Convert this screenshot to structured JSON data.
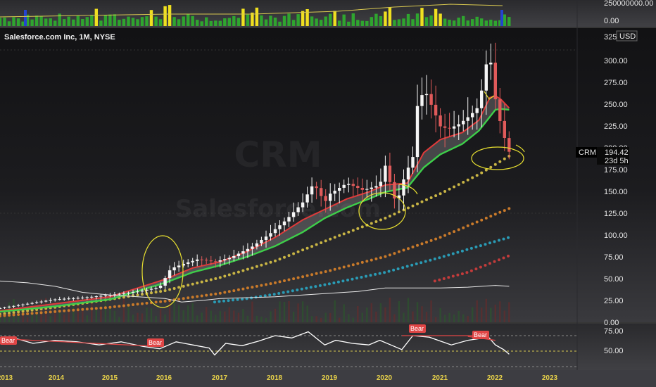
{
  "title": "Salesforce.com Inc, 1M, NYSE",
  "watermark": "Salesforce.com",
  "watermark_ticker": "CRM",
  "currency": "USD",
  "last_price": {
    "symbol": "CRM",
    "value": "194.42",
    "countdown": "23d 5h"
  },
  "volume_axis": [
    "250000000.00",
    "0.00"
  ],
  "price_ticks": [
    "325.0",
    "300.00",
    "275.00",
    "250.00",
    "225.00",
    "200.00",
    "175.00",
    "150.00",
    "125.00",
    "100.00",
    "75.00",
    "50.00",
    "25.00",
    "0.00"
  ],
  "rsi_ticks": [
    "75.00",
    "50.00"
  ],
  "time_ticks": [
    "2013",
    "2014",
    "2015",
    "2016",
    "2017",
    "2018",
    "2019",
    "2020",
    "2021",
    "2022",
    "2023"
  ],
  "rsi_badges": [
    "Bear",
    "Bear",
    "Bear",
    "Bear"
  ],
  "colors": {
    "up": "#f5f5f5",
    "down": "#e05a5a",
    "ema_fast": "#e03a3a",
    "ema_slow": "#3ecf4a",
    "ma_yellow": "#c9b545",
    "ma_orange": "#c97a2a",
    "ma_blue": "#2a9bb5",
    "ma_red": "#c23b3b",
    "annotation": "#e8e030",
    "axis_text": "#e6e6e6",
    "year_text": "#e8d24a"
  },
  "chart_data": {
    "type": "candlestick",
    "title": "Salesforce.com Inc, 1M, NYSE",
    "x_range": [
      2013.0,
      2023.6
    ],
    "ylim": [
      0,
      325
    ],
    "price_path": [
      [
        2013.0,
        17
      ],
      [
        2013.5,
        22
      ],
      [
        2014.0,
        27
      ],
      [
        2014.5,
        29
      ],
      [
        2015.0,
        32
      ],
      [
        2015.5,
        36
      ],
      [
        2015.9,
        41
      ],
      [
        2016.1,
        62
      ],
      [
        2016.3,
        67
      ],
      [
        2016.6,
        73
      ],
      [
        2016.9,
        70
      ],
      [
        2017.2,
        75
      ],
      [
        2017.6,
        88
      ],
      [
        2017.9,
        102
      ],
      [
        2018.2,
        118
      ],
      [
        2018.5,
        138
      ],
      [
        2018.7,
        160
      ],
      [
        2018.9,
        138
      ],
      [
        2019.0,
        148
      ],
      [
        2019.3,
        160
      ],
      [
        2019.6,
        152
      ],
      [
        2019.9,
        158
      ],
      [
        2020.0,
        180
      ],
      [
        2020.2,
        135
      ],
      [
        2020.35,
        168
      ],
      [
        2020.5,
        190
      ],
      [
        2020.6,
        260
      ],
      [
        2020.75,
        262
      ],
      [
        2020.9,
        240
      ],
      [
        2021.0,
        225
      ],
      [
        2021.15,
        222
      ],
      [
        2021.35,
        228
      ],
      [
        2021.55,
        238
      ],
      [
        2021.7,
        248
      ],
      [
        2021.85,
        302
      ],
      [
        2021.95,
        296
      ],
      [
        2022.0,
        256
      ],
      [
        2022.08,
        232
      ],
      [
        2022.17,
        211
      ],
      [
        2022.25,
        196
      ]
    ],
    "ema_fast_path": [
      [
        2013.0,
        14
      ],
      [
        2014.0,
        22
      ],
      [
        2015.0,
        30
      ],
      [
        2016.0,
        50
      ],
      [
        2016.5,
        63
      ],
      [
        2017.0,
        70
      ],
      [
        2017.5,
        82
      ],
      [
        2018.0,
        98
      ],
      [
        2018.5,
        118
      ],
      [
        2018.9,
        130
      ],
      [
        2019.3,
        142
      ],
      [
        2019.7,
        150
      ],
      [
        2020.0,
        158
      ],
      [
        2020.4,
        160
      ],
      [
        2020.7,
        195
      ],
      [
        2021.0,
        210
      ],
      [
        2021.4,
        218
      ],
      [
        2021.7,
        232
      ],
      [
        2021.9,
        258
      ],
      [
        2022.0,
        260
      ],
      [
        2022.1,
        256
      ],
      [
        2022.25,
        246
      ]
    ],
    "ema_slow_path": [
      [
        2013.0,
        13
      ],
      [
        2014.0,
        19
      ],
      [
        2015.0,
        27
      ],
      [
        2016.0,
        46
      ],
      [
        2016.5,
        58
      ],
      [
        2017.0,
        66
      ],
      [
        2017.5,
        76
      ],
      [
        2018.0,
        88
      ],
      [
        2018.5,
        104
      ],
      [
        2018.9,
        120
      ],
      [
        2019.3,
        132
      ],
      [
        2019.7,
        142
      ],
      [
        2020.0,
        150
      ],
      [
        2020.4,
        155
      ],
      [
        2020.7,
        178
      ],
      [
        2021.0,
        193
      ],
      [
        2021.4,
        205
      ],
      [
        2021.7,
        220
      ],
      [
        2021.9,
        236
      ],
      [
        2022.0,
        244
      ],
      [
        2022.1,
        245
      ],
      [
        2022.25,
        244
      ]
    ],
    "ma_yellow_path": [
      [
        2013.0,
        10
      ],
      [
        2014.0,
        18
      ],
      [
        2015.0,
        27
      ],
      [
        2016.0,
        37
      ],
      [
        2017.0,
        52
      ],
      [
        2018.0,
        71
      ],
      [
        2019.0,
        96
      ],
      [
        2020.0,
        120
      ],
      [
        2021.0,
        148
      ],
      [
        2021.7,
        170
      ],
      [
        2022.25,
        191
      ]
    ],
    "ma_orange_path": [
      [
        2013.0,
        8
      ],
      [
        2014.0,
        13
      ],
      [
        2015.0,
        18
      ],
      [
        2016.0,
        25
      ],
      [
        2017.0,
        34
      ],
      [
        2018.0,
        46
      ],
      [
        2019.0,
        60
      ],
      [
        2020.0,
        76
      ],
      [
        2021.0,
        98
      ],
      [
        2022.25,
        131
      ]
    ],
    "ma_blue_path": [
      [
        2016.9,
        24
      ],
      [
        2017.5,
        28
      ],
      [
        2018.0,
        33
      ],
      [
        2019.0,
        45
      ],
      [
        2020.0,
        58
      ],
      [
        2021.0,
        75
      ],
      [
        2022.25,
        98
      ]
    ],
    "ma_red_path": [
      [
        2020.9,
        48
      ],
      [
        2021.5,
        58
      ],
      [
        2022.25,
        77
      ]
    ],
    "white_line_path": [
      [
        2013.0,
        48
      ],
      [
        2013.5,
        46
      ],
      [
        2014.0,
        42
      ],
      [
        2014.5,
        35
      ],
      [
        2015.0,
        32
      ],
      [
        2015.5,
        30
      ],
      [
        2016.0,
        28
      ],
      [
        2016.3,
        24
      ],
      [
        2016.7,
        26
      ],
      [
        2017.0,
        28
      ],
      [
        2017.5,
        29
      ],
      [
        2018.0,
        30
      ],
      [
        2018.5,
        32
      ],
      [
        2019.0,
        34
      ],
      [
        2019.5,
        36
      ],
      [
        2020.0,
        40
      ],
      [
        2020.5,
        40
      ],
      [
        2021.0,
        40
      ],
      [
        2021.5,
        41
      ],
      [
        2022.0,
        43
      ],
      [
        2022.25,
        42
      ]
    ],
    "rsi_path": [
      [
        2013.0,
        64
      ],
      [
        2013.3,
        66
      ],
      [
        2013.6,
        60
      ],
      [
        2014.0,
        64
      ],
      [
        2014.4,
        62
      ],
      [
        2014.8,
        58
      ],
      [
        2015.2,
        62
      ],
      [
        2015.6,
        56
      ],
      [
        2015.9,
        53
      ],
      [
        2016.2,
        62
      ],
      [
        2016.5,
        58
      ],
      [
        2016.8,
        54
      ],
      [
        2016.9,
        45
      ],
      [
        2017.1,
        60
      ],
      [
        2017.4,
        57
      ],
      [
        2017.7,
        63
      ],
      [
        2018.0,
        70
      ],
      [
        2018.3,
        67
      ],
      [
        2018.6,
        75
      ],
      [
        2018.9,
        58
      ],
      [
        2019.1,
        64
      ],
      [
        2019.4,
        60
      ],
      [
        2019.7,
        58
      ],
      [
        2019.9,
        64
      ],
      [
        2020.1,
        58
      ],
      [
        2020.3,
        52
      ],
      [
        2020.5,
        70
      ],
      [
        2020.8,
        68
      ],
      [
        2021.0,
        63
      ],
      [
        2021.2,
        58
      ],
      [
        2021.5,
        64
      ],
      [
        2021.7,
        66
      ],
      [
        2021.85,
        70
      ],
      [
        2022.0,
        58
      ],
      [
        2022.15,
        52
      ],
      [
        2022.25,
        46
      ]
    ],
    "rsi_ylim": [
      25,
      85
    ],
    "rsi_levels": [
      70,
      50,
      30
    ]
  }
}
